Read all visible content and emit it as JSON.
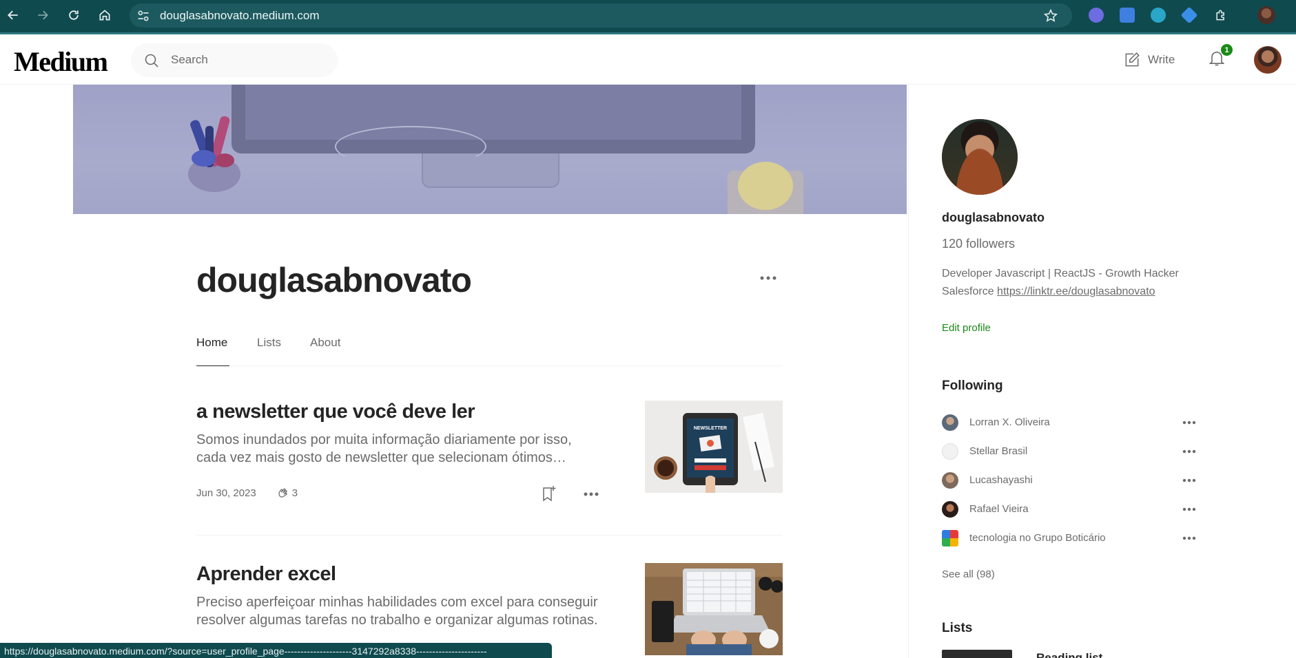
{
  "browser": {
    "url": "douglasabnovato.medium.com",
    "status_url": "https://douglasabnovato.medium.com/?source=user_profile_page---------------------3147292a8338----------------------",
    "accent_color": "#0f4a4f"
  },
  "header": {
    "logo": "Medium",
    "search_placeholder": "Search",
    "write_label": "Write",
    "notification_count": "1"
  },
  "profile": {
    "name": "douglasabnovato",
    "tabs": [
      {
        "label": "Home",
        "active": true
      },
      {
        "label": "Lists",
        "active": false
      },
      {
        "label": "About",
        "active": false
      }
    ]
  },
  "posts": [
    {
      "title": "a newsletter que você deve ler",
      "excerpt": "Somos inundados por muita informação diariamente por isso, cada vez mais gosto de newsletter que selecionam ótimos…",
      "date": "Jun 30, 2023",
      "claps": "3",
      "thumb_text": "NEWSLETTER"
    },
    {
      "title": "Aprender excel",
      "excerpt": "Preciso aperfeiçoar minhas habilidades com excel para conseguir resolver algumas tarefas no trabalho e organizar algumas rotinas."
    }
  ],
  "sidebar": {
    "name": "douglasabnovato",
    "followers": "120 followers",
    "bio_text": "Developer Javascript | ReactJS - Growth Hacker Salesforce ",
    "bio_link": "https://linktr.ee/douglasabnovato",
    "edit_profile": "Edit profile",
    "following_heading": "Following",
    "following": [
      {
        "name": "Lorran X. Oliveira"
      },
      {
        "name": "Stellar Brasil"
      },
      {
        "name": "Lucashayashi"
      },
      {
        "name": "Rafael Vieira"
      },
      {
        "name": "tecnologia no Grupo Boticário"
      }
    ],
    "see_all": "See all (98)",
    "lists_heading": "Lists",
    "reading_list": "Reading list"
  }
}
